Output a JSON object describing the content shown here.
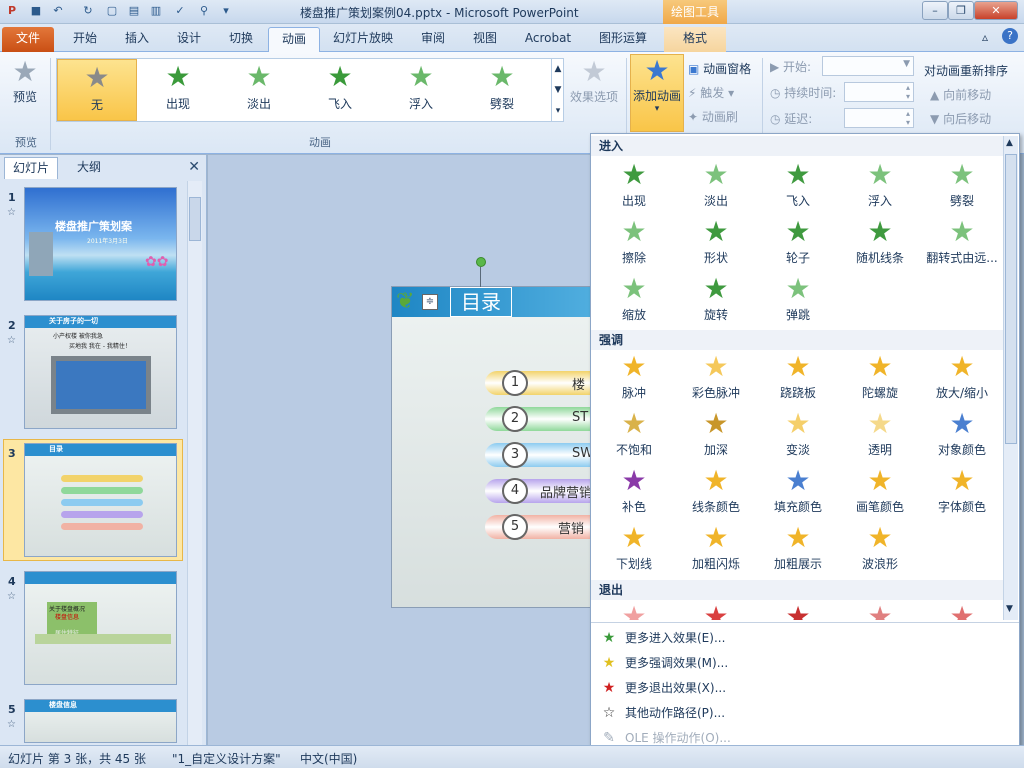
{
  "titlebar": {
    "document_title": "楼盘推广策划案例04.pptx - Microsoft PowerPoint",
    "contextual_group": "绘图工具",
    "quick_access": [
      "save-icon",
      "undo-icon",
      "redo-icon",
      "new-icon",
      "open-icon",
      "print-preview-icon",
      "spelling-icon",
      "zoom-icon",
      "customize-icon"
    ]
  },
  "tabs": {
    "file": "文件",
    "items": [
      "开始",
      "插入",
      "设计",
      "切换",
      "动画",
      "幻灯片放映",
      "审阅",
      "视图",
      "Acrobat",
      "图形运算",
      "格式"
    ],
    "active": "动画"
  },
  "ribbon": {
    "preview_label": "预览",
    "preview_group": "预览",
    "animation_group": "动画",
    "gallery": [
      {
        "label": "无",
        "color": "#8a8a8a",
        "selected": true
      },
      {
        "label": "出现",
        "color": "#3a9a3a"
      },
      {
        "label": "淡出",
        "color": "#6ab86a"
      },
      {
        "label": "飞入",
        "color": "#3a9a3a"
      },
      {
        "label": "浮入",
        "color": "#6ab86a"
      },
      {
        "label": "劈裂",
        "color": "#6ab86a"
      }
    ],
    "effect_options": "效果选项",
    "add_animation": "添加动画",
    "animation_pane": "动画窗格",
    "trigger": "触发",
    "animation_painter": "动画刷",
    "start_label": "开始:",
    "duration_label": "持续时间:",
    "delay_label": "延迟:",
    "reorder_title": "对动画重新排序",
    "move_earlier": "向前移动",
    "move_later": "向后移动"
  },
  "left_panel": {
    "tabs": [
      "幻灯片",
      "大纲"
    ],
    "active_tab": "幻灯片",
    "slides": [
      {
        "num": "1",
        "title": "楼盘推广策划案",
        "subtitle": "2011年3月3日"
      },
      {
        "num": "2",
        "title": "关于房子的一切",
        "lines": [
          "小产权楼  被你我急",
          "买地我  我在 - 我精住！"
        ]
      },
      {
        "num": "3",
        "title": "目录",
        "selected": true
      },
      {
        "num": "4",
        "title": "关于楼盘概况",
        "lines": [
          "楼盘信息",
          "居住特征"
        ]
      },
      {
        "num": "5",
        "title": "楼盘信息"
      }
    ]
  },
  "slide": {
    "title": "目录",
    "items": [
      {
        "num": "1",
        "text": "楼",
        "color": "#f2d36a"
      },
      {
        "num": "2",
        "text": "ST",
        "color": "#8fd89a"
      },
      {
        "num": "3",
        "text": "SW",
        "color": "#8ccbf0"
      },
      {
        "num": "4",
        "text": "品牌营销",
        "color": "#b7a4ec"
      },
      {
        "num": "5",
        "text": "营销",
        "color": "#f1b2a4"
      }
    ]
  },
  "dropdown": {
    "sections": {
      "entrance": "进入",
      "emphasis": "强调",
      "exit": "退出"
    },
    "entrance": [
      {
        "label": "出现",
        "color": "#3f9a3f"
      },
      {
        "label": "淡出",
        "color": "#7cc27c"
      },
      {
        "label": "飞入",
        "color": "#3f9a3f"
      },
      {
        "label": "浮入",
        "color": "#7cc27c"
      },
      {
        "label": "劈裂",
        "color": "#7cc27c"
      },
      {
        "label": "擦除",
        "color": "#7cc27c"
      },
      {
        "label": "形状",
        "color": "#3f9a3f"
      },
      {
        "label": "轮子",
        "color": "#3f9a3f"
      },
      {
        "label": "随机线条",
        "color": "#3f9a3f"
      },
      {
        "label": "翻转式由远...",
        "color": "#7cc27c"
      },
      {
        "label": "缩放",
        "color": "#7cc27c"
      },
      {
        "label": "旋转",
        "color": "#3f9a3f"
      },
      {
        "label": "弹跳",
        "color": "#7cc27c"
      }
    ],
    "emphasis": [
      {
        "label": "脉冲",
        "color": "#f0b429"
      },
      {
        "label": "彩色脉冲",
        "color": "#f5c85a"
      },
      {
        "label": "跷跷板",
        "color": "#f0b429"
      },
      {
        "label": "陀螺旋",
        "color": "#f0b429"
      },
      {
        "label": "放大/缩小",
        "color": "#f0b429"
      },
      {
        "label": "不饱和",
        "color": "#d9b24a"
      },
      {
        "label": "加深",
        "color": "#c8962a"
      },
      {
        "label": "变淡",
        "color": "#f5cf6a"
      },
      {
        "label": "透明",
        "color": "#f5d98a"
      },
      {
        "label": "对象颜色",
        "color": "#4a7fd0"
      },
      {
        "label": "补色",
        "color": "#8a3aa8"
      },
      {
        "label": "线条颜色",
        "color": "#f0b429"
      },
      {
        "label": "填充颜色",
        "color": "#4a7fd0"
      },
      {
        "label": "画笔颜色",
        "color": "#f0b429"
      },
      {
        "label": "字体颜色",
        "color": "#f0b429"
      },
      {
        "label": "下划线",
        "color": "#f0b429"
      },
      {
        "label": "加粗闪烁",
        "color": "#f0b429"
      },
      {
        "label": "加粗展示",
        "color": "#f0b429"
      },
      {
        "label": "波浪形",
        "color": "#f0b429"
      }
    ],
    "exit_colors": [
      "#f0a0a0",
      "#d94040",
      "#c83030",
      "#e08080",
      "#e07070"
    ],
    "menu": [
      {
        "label": "更多进入效果(E)...",
        "icon": "green-star-icon",
        "glyph": "★",
        "color": "#3a9a3a"
      },
      {
        "label": "更多强调效果(M)...",
        "icon": "yellow-star-icon",
        "glyph": "★",
        "color": "#e0c020"
      },
      {
        "label": "更多退出效果(X)...",
        "icon": "red-star-icon",
        "glyph": "★",
        "color": "#d02020"
      },
      {
        "label": "其他动作路径(P)...",
        "icon": "outline-star-icon",
        "glyph": "☆",
        "color": "#333333"
      },
      {
        "label": "OLE 操作动作(O)...",
        "icon": "ole-action-icon",
        "glyph": "✎",
        "color": "#a2adbb",
        "disabled": true
      }
    ]
  },
  "statusbar": {
    "slide_info": "幻灯片 第 3 张，共 45 张",
    "theme": "\"1_自定义设计方案\"",
    "language": "中文(中国)"
  }
}
